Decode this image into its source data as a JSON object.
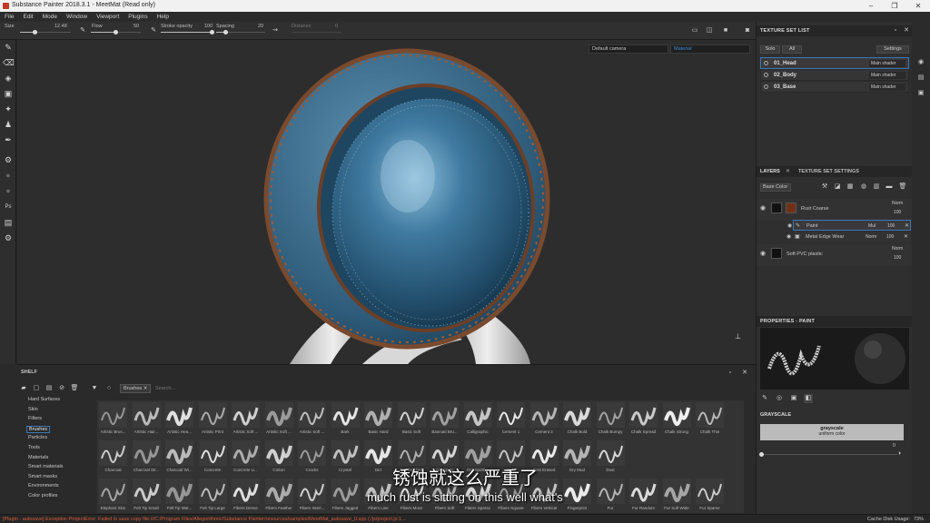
{
  "window": {
    "title": "Substance Painter 2018.3.1 - MeetMat (Read only)"
  },
  "menu": [
    "File",
    "Edit",
    "Mode",
    "Window",
    "Viewport",
    "Plugins",
    "Help"
  ],
  "toolbar": {
    "size_label": "Size",
    "size_value": "12.48",
    "size_fraction": 0.3,
    "flow_label": "Flow",
    "flow_value": "50",
    "flow_fraction": 0.5,
    "stroke_label": "Stroke opacity",
    "stroke_value": "100",
    "stroke_fraction": 1.0,
    "spacing_label": "Spacing",
    "spacing_value": "20",
    "spacing_fraction": 0.2,
    "distance_label": "Distance",
    "distance_value": "0"
  },
  "viewport": {
    "camera_select": "Default camera",
    "mode_select": "Material"
  },
  "texture_set_list": {
    "title": "TEXTURE SET LIST",
    "solo": "Solo",
    "all": "All",
    "settings": "Settings",
    "items": [
      {
        "name": "01_Head",
        "shader": "Main shader",
        "active": true
      },
      {
        "name": "02_Body",
        "shader": "Main shader",
        "active": false
      },
      {
        "name": "03_Base",
        "shader": "Main shader",
        "active": false
      }
    ]
  },
  "layers": {
    "tab_layers": "LAYERS",
    "tab_settings": "TEXTURE SET SETTINGS",
    "channel": "Base Color",
    "rows": [
      {
        "name": "Rust Coarse",
        "blend": "Norm",
        "opacity": "100"
      },
      {
        "name": "Paint",
        "blend": "Mul",
        "opacity": "100"
      },
      {
        "name": "Metal Edge Wear",
        "blend": "Norm",
        "opacity": "100"
      },
      {
        "name": "Soft PVC plastic",
        "blend": "Norm",
        "opacity": "100"
      }
    ]
  },
  "properties": {
    "title": "PROPERTIES - PAINT",
    "section": "GRAYSCALE",
    "value_name": "grayscale",
    "value_sub": "uniform color",
    "slider_value": "0",
    "slider_fraction": 0.0
  },
  "shelf": {
    "title": "SHELF",
    "filter_tag": "Brushes",
    "search_placeholder": "Search...",
    "categories": [
      "Hard Surfaces",
      "Skin",
      "Filters",
      "Brushes",
      "Particles",
      "Tools",
      "Materials",
      "Smart materials",
      "Smart masks",
      "Environments",
      "Color profiles"
    ],
    "selected_category": "Brushes",
    "brushes_row1": [
      "Artistic Brus...",
      "Artistic Hair...",
      "Artistic Hea...",
      "Artistic Print",
      "Artistic Soft ...",
      "Artistic Soft ...",
      "Artistic Soft ...",
      "Bark",
      "Basic Hard",
      "Basic Soft",
      "Basmati Bru...",
      "Calligraphic",
      "Cement 1",
      "Cement 2",
      "Chalk Bold",
      "Chalk Bumpy",
      "Chalk Spread",
      "Chalk Strong",
      "Chalk Thin"
    ],
    "brushes_row2": [
      "Charcoal",
      "Charcoal Str...",
      "Charcoal Wi...",
      "Concrete",
      "Concrete Li...",
      "Cotton",
      "Cracks",
      "Crystal",
      "Dirt",
      "Dirt Brushed",
      "Dirt Spots",
      "Dirt Spotti...",
      "Dots",
      "Dots Erased",
      "Dry Mud",
      "Dust"
    ],
    "brushes_row3": [
      "Elephant Skin",
      "Felt Tip Small",
      "Felt Tip Wat...",
      "Felt Tip Large",
      "Fibers Dense",
      "Fibers Feather",
      "Fibers Interl...",
      "Fibers Jagged",
      "Fibers Line",
      "Fibers Moss",
      "Fibers Soft",
      "Fibers Sparse",
      "Fibers Square",
      "Fibers Vertical",
      "Fingerprint",
      "Fur",
      "Fur Random",
      "Fur Soft Wide",
      "Fur Sparse"
    ]
  },
  "status": {
    "error": "[Plugin - autosave] Exception ProjectError: Failed to save copy file:///C:/Program Files/Allegorithmic/Substance Painter/resources/samples/MeetMat_autosave_0.spp (:/js/project.js:1...",
    "cache": "Cache Disk Usage:",
    "cache_value": "73%"
  },
  "subtitles": {
    "cn": "锈蚀就这么严重了",
    "en": "much rust is sitting on this well what's"
  }
}
